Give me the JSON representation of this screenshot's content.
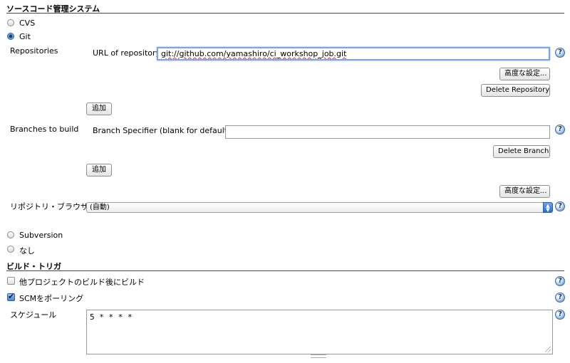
{
  "scm_section": {
    "title": "ソースコード管理システム",
    "options": {
      "cvs": "CVS",
      "git": "Git",
      "subversion": "Subversion",
      "none": "なし"
    }
  },
  "repositories": {
    "label": "Repositories",
    "url_label": "URL of repository",
    "url_value": "git://github.com/yamashiro/ci_workshop_job.git",
    "advanced_button": "高度な設定...",
    "delete_button": "Delete Repository",
    "add_button": "追加"
  },
  "branches": {
    "label": "Branches to build",
    "specifier_label": "Branch Specifier (blank for default):",
    "specifier_value": "",
    "delete_button": "Delete Branch",
    "add_button": "追加",
    "advanced_button": "高度な設定..."
  },
  "repo_browser": {
    "label": "リポジトリ・ブラウザ",
    "selected": "(自動)"
  },
  "triggers": {
    "title": "ビルド・トリガ",
    "after_other_projects": "他プロジェクトのビルド後にビルド",
    "poll_scm": "SCMをポーリング",
    "schedule_label": "スケジュール",
    "schedule_value": "5 * * * *"
  },
  "help_glyph": "?",
  "icons": {
    "help": "help-icon",
    "select_arrows": "up-down-arrows-icon"
  },
  "colors": {
    "section_rule": "#4a4a4a",
    "focus_ring": "#7ba7e1",
    "select_accent": "#2d6cc8"
  }
}
